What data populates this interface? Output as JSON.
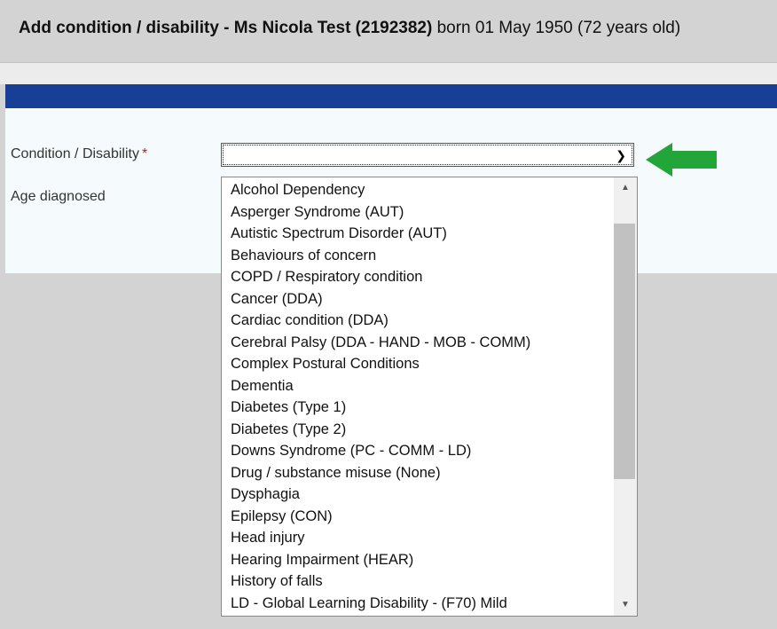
{
  "header": {
    "title_bold": "Add condition / disability - Ms Nicola Test (2192382)",
    "title_rest": " born 01 May 1950 (72 years old)"
  },
  "form": {
    "condition_label": "Condition / Disability",
    "required_marker": "*",
    "condition_value": "",
    "age_label": "Age diagnosed"
  },
  "dropdown": {
    "options": [
      "Alcohol Dependency",
      "Asperger Syndrome (AUT)",
      "Autistic Spectrum Disorder (AUT)",
      "Behaviours of concern",
      "COPD / Respiratory condition",
      "Cancer (DDA)",
      "Cardiac condition (DDA)",
      "Cerebral Palsy (DDA - HAND - MOB - COMM)",
      "Complex Postural Conditions",
      "Dementia",
      "Diabetes (Type 1)",
      "Diabetes (Type 2)",
      "Downs Syndrome (PC - COMM - LD)",
      "Drug / substance misuse (None)",
      "Dysphagia",
      "Epilepsy (CON)",
      "Head injury",
      "Hearing Impairment (HEAR)",
      "History of falls",
      "LD - Global Learning Disability - (F70) Mild"
    ]
  },
  "icons": {
    "chevron": "chevron-down-icon",
    "arrow": "arrow-left-icon"
  },
  "colors": {
    "header_bg": "#d3d3d3",
    "brand_blue": "#173f97",
    "required": "#d4111e",
    "annotation_green": "#22a63a"
  }
}
